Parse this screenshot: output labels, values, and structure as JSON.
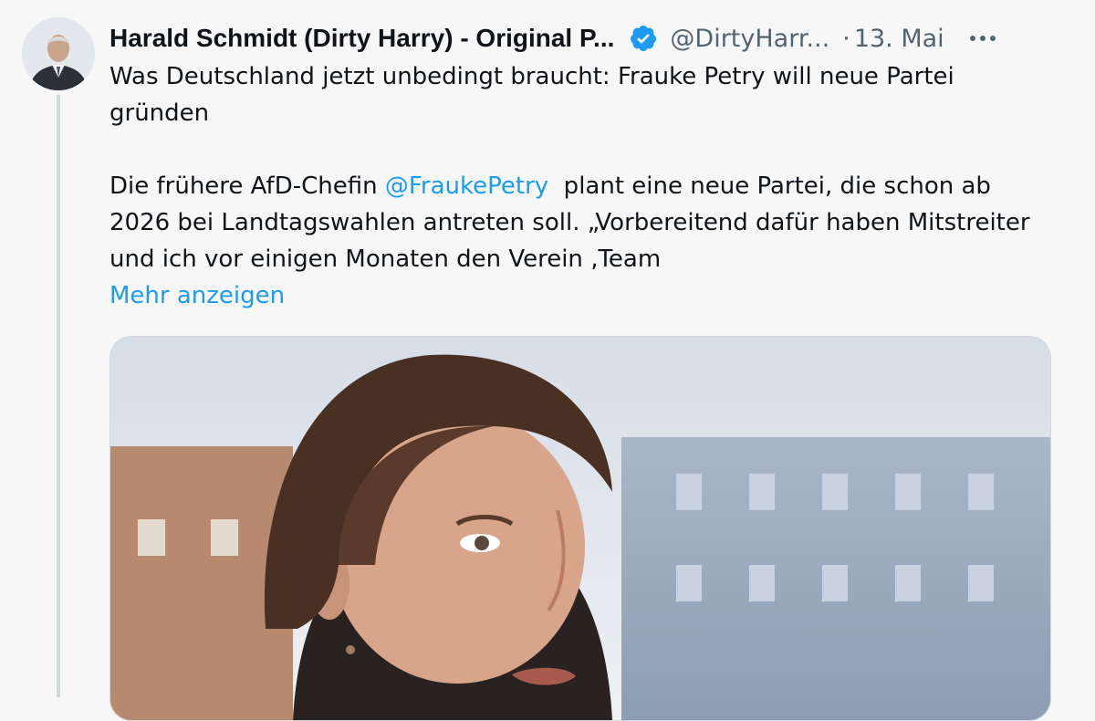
{
  "author": {
    "name": "Harald Schmidt (Dirty Harry) - Original P...",
    "handle": "@DirtyHarr...",
    "separator": "·",
    "date": "13. Mai"
  },
  "tweet": {
    "line1": "Was Deutschland jetzt unbedingt braucht: Frauke Petry will neue Partei gründen",
    "p2_before": "Die frühere AfD-Chefin ",
    "mention": "@FraukePetry",
    "p2_after": "  plant eine neue Partei, die schon ab 2026 bei Landtagswahlen antreten soll. „Vorbereitend dafür haben Mitstreiter und ich vor einigen Monaten den Verein ‚Team",
    "show_more": "Mehr anzeigen"
  },
  "icons": {
    "verified": "verified-badge-icon",
    "more": "more-dots-icon"
  },
  "colors": {
    "link": "#1d9bf0",
    "secondary_text": "#536471"
  }
}
